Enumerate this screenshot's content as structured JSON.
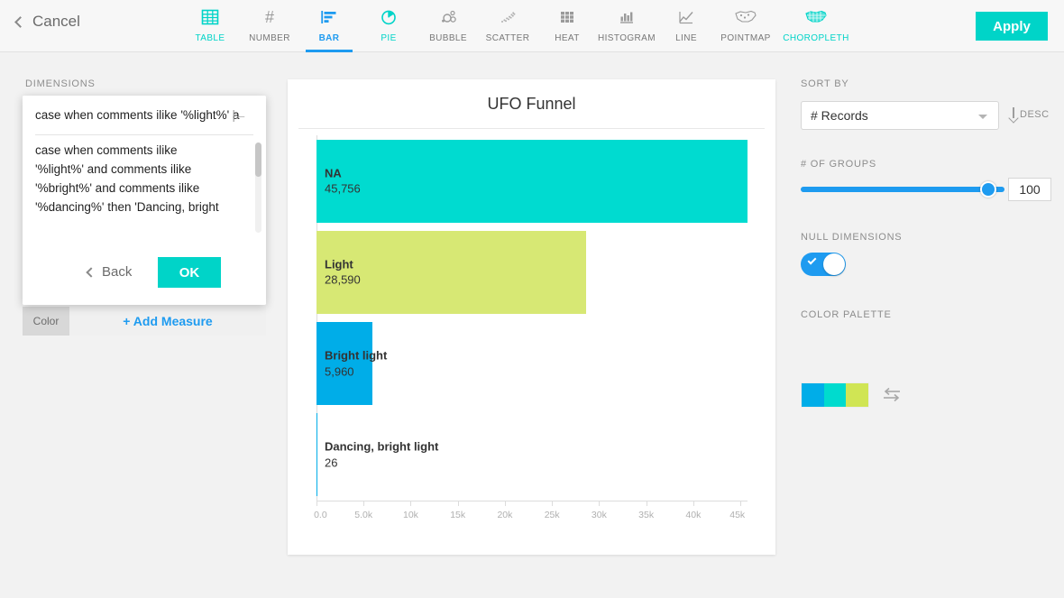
{
  "topbar": {
    "cancel_label": "Cancel",
    "apply_label": "Apply",
    "tabs": [
      {
        "label": "TABLE",
        "icon": "table-icon",
        "state": "teal"
      },
      {
        "label": "NUMBER",
        "icon": "number-hash-icon",
        "state": "normal"
      },
      {
        "label": "BAR",
        "icon": "bar-chart-icon",
        "state": "active"
      },
      {
        "label": "PIE",
        "icon": "pie-chart-icon",
        "state": "teal"
      },
      {
        "label": "BUBBLE",
        "icon": "bubble-chart-icon",
        "state": "normal"
      },
      {
        "label": "SCATTER",
        "icon": "scatter-plot-icon",
        "state": "normal"
      },
      {
        "label": "HEAT",
        "icon": "heat-map-icon",
        "state": "normal"
      },
      {
        "label": "HISTOGRAM",
        "icon": "histogram-icon",
        "state": "normal"
      },
      {
        "label": "LINE",
        "icon": "line-chart-icon",
        "state": "normal"
      },
      {
        "label": "POINTMAP",
        "icon": "pointmap-icon",
        "state": "normal"
      },
      {
        "label": "CHOROPLETH",
        "icon": "choropleth-icon",
        "state": "teal"
      }
    ]
  },
  "left_panel": {
    "dimensions_label": "DIMENSIONS",
    "measure_key_label": "Color",
    "add_measure_label": "+ Add Measure",
    "popup": {
      "input_value": "case when comments ilike '%light%' a",
      "expression_text": "case when comments ilike '%light%' and comments ilike '%bright%' and comments ilike '%dancing%' then 'Dancing, bright",
      "tab_icon": "indent-left-icon",
      "back_label": "Back",
      "ok_label": "OK"
    }
  },
  "chart_data": {
    "type": "bar",
    "orientation": "horizontal",
    "title": "UFO Funnel",
    "xlabel": "",
    "ylabel": "",
    "categories": [
      "NA",
      "Light",
      "Bright light",
      "Dancing, bright light"
    ],
    "values": [
      45756,
      28590,
      5960,
      26
    ],
    "value_labels": [
      "45,756",
      "28,590",
      "5,960",
      "26"
    ],
    "colors": [
      "#00dbd0",
      "#d7e874",
      "#00ade8",
      "#00ade8"
    ],
    "xlim": [
      0,
      45756
    ],
    "xticks": [
      0,
      5000,
      10000,
      15000,
      20000,
      25000,
      30000,
      35000,
      40000,
      45000
    ],
    "xtick_labels": [
      "0.0",
      "5.0k",
      "10k",
      "15k",
      "20k",
      "25k",
      "30k",
      "35k",
      "40k",
      "45k"
    ],
    "grid": false,
    "legend": "none"
  },
  "right_panel": {
    "sort_by_label": "SORT BY",
    "sort_by_value": "# Records",
    "sort_direction_label": "DESC",
    "groups_label": "# OF GROUPS",
    "groups_value": "100",
    "null_dimensions_label": "NULL DIMENSIONS",
    "null_dimensions_on": true,
    "color_palette_label": "COLOR PALETTE",
    "palette_colors": [
      "#00ade8",
      "#00dbce",
      "#d0e554"
    ],
    "swap_icon": "swap-arrows-icon"
  },
  "theme": {
    "accent_teal": "#00d4c8",
    "accent_blue": "#1e9bf0",
    "page_bg": "#f2f2f2"
  }
}
